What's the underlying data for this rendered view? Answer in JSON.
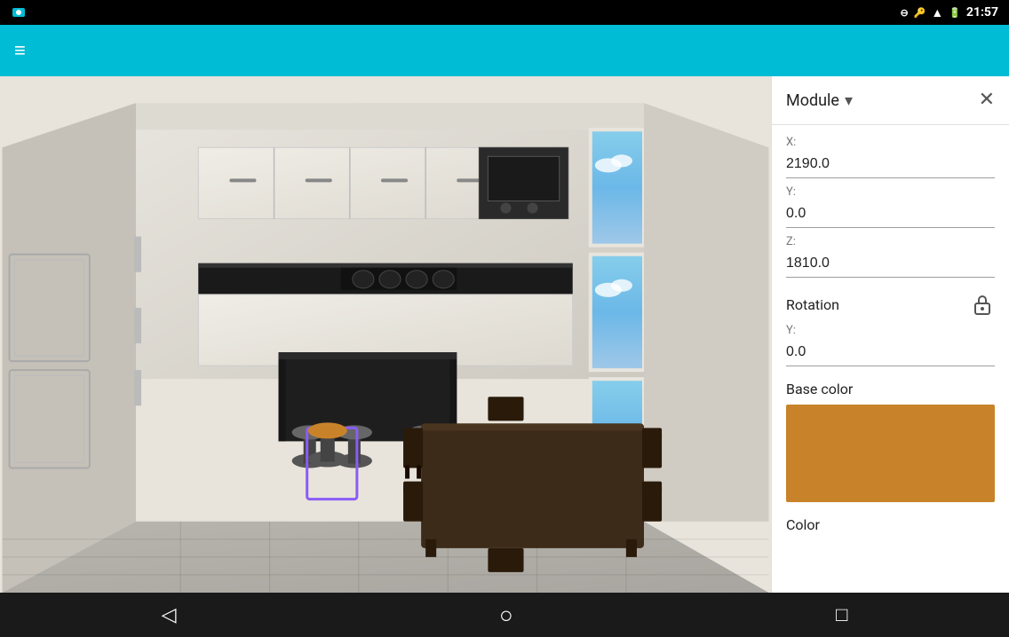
{
  "statusBar": {
    "time": "21:57",
    "icons": [
      "signal",
      "wifi",
      "battery"
    ]
  },
  "toolbar": {
    "menuIcon": "≡",
    "title": ""
  },
  "panel": {
    "title": "Module",
    "closeIcon": "✕",
    "dropdownIcon": "▾",
    "fields": {
      "xLabel": "X:",
      "xValue": "2190.0",
      "yLabel": "Y:",
      "yValue": "0.0",
      "zLabel": "Z:",
      "zValue": "1810.0"
    },
    "rotation": {
      "label": "Rotation",
      "yLabel": "Y:",
      "yValue": "0.0"
    },
    "baseColor": {
      "label": "Base color",
      "color": "#C8832A"
    },
    "color": {
      "label": "Color"
    }
  },
  "bottomNav": {
    "backIcon": "◁",
    "homeIcon": "○",
    "recentIcon": "□"
  }
}
